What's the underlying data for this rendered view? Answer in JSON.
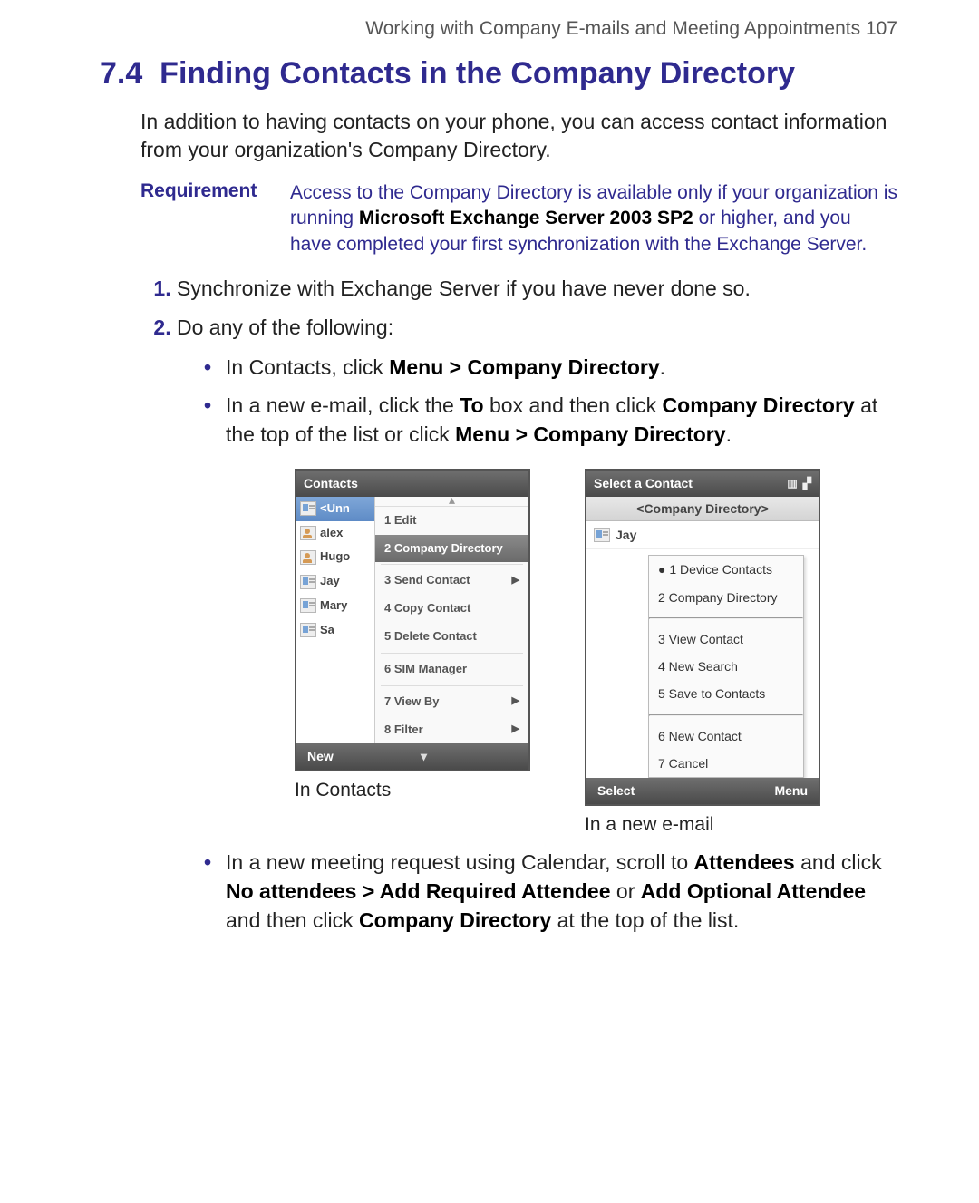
{
  "header": {
    "running_head": "Working with Company E-mails and Meeting Appointments  107"
  },
  "section": {
    "number": "7.4",
    "title": "Finding Contacts in the Company Directory"
  },
  "intro": "In addition to having contacts on your phone, you can access contact information from your organization's Company Directory.",
  "requirement": {
    "label": "Requirement",
    "text_pre": "Access to the Company Directory is available only if your organization is running ",
    "bold": "Microsoft Exchange Server 2003 SP2",
    "text_post": " or higher, and you have completed your first synchronization with the Exchange Server."
  },
  "steps": {
    "s1": "Synchronize with Exchange Server if you have never done so.",
    "s2": "Do any of the following:",
    "b1_pre": "In Contacts, click ",
    "b1_bold": "Menu > Company Directory",
    "b1_post": ".",
    "b2_pre": "In a new e-mail, click the ",
    "b2_b1": "To",
    "b2_mid1": " box and then click ",
    "b2_b2": "Company Directory",
    "b2_mid2": " at the top of the list or click ",
    "b2_b3": "Menu > Company Directory",
    "b2_post": ".",
    "b3_pre": "In a new meeting request using Calendar, scroll to ",
    "b3_b1": "Attendees",
    "b3_mid1": " and click ",
    "b3_b2": "No attendees > Add Required Attendee",
    "b3_mid2": " or ",
    "b3_b3": "Add Optional Attendee",
    "b3_mid3": " and then click ",
    "b3_b4": "Company Directory",
    "b3_post": " at the top of the list."
  },
  "captions": {
    "left": "In Contacts",
    "right": "In a new e-mail"
  },
  "phone_left": {
    "title": "Contacts",
    "soft_left": "New",
    "contacts": [
      "<Unn",
      "alex",
      "Hugo",
      "Jay",
      "Mary",
      "Sa"
    ],
    "menu": {
      "m1": "1 Edit",
      "m2": "2 Company Directory",
      "m3": "3 Send Contact",
      "m4": "4 Copy Contact",
      "m5": "5 Delete Contact",
      "m6": "6 SIM Manager",
      "m7": "7 View By",
      "m8": "8 Filter"
    }
  },
  "phone_right": {
    "title": "Select a Contact",
    "subhead": "<Company Directory>",
    "row1": "Jay",
    "soft_left": "Select",
    "soft_right": "Menu",
    "menu": {
      "m1": "1 Device Contacts",
      "m2": "2 Company Directory",
      "m3": "3 View Contact",
      "m4": "4 New Search",
      "m5": "5 Save to Contacts",
      "m6": "6 New Contact",
      "m7": "7 Cancel"
    }
  }
}
